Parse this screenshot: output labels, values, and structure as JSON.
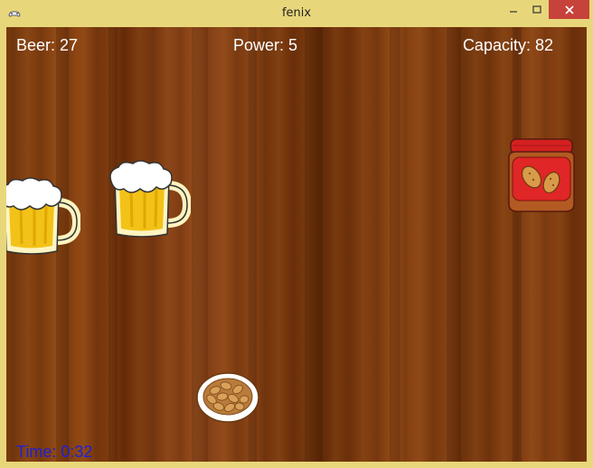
{
  "window": {
    "title": "fenix",
    "icons": {
      "app": "gamepad-icon",
      "minimize": "minimize-icon",
      "maximize": "maximize-icon",
      "close": "close-icon"
    },
    "close_color": "#c7423a",
    "frame_color": "#e8d77a"
  },
  "hud": {
    "beer": "Beer: 27",
    "power": "Power: 5",
    "capacity": "Capacity: 82",
    "time": "Time: 0:32",
    "time_color": "#1d20d8"
  },
  "sprites": {
    "beer_mug": "beer-mug-icon",
    "peanut_jar": "peanut-butter-jar-icon",
    "peanut_bowl": "peanut-bowl-icon"
  }
}
